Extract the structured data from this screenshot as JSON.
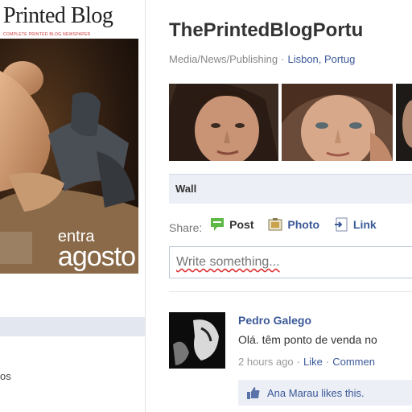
{
  "left": {
    "magazine": {
      "logo": "Printed Blog",
      "tagline": "COMPLETE PRINTED BLOG NEWSPAPER",
      "cover_line1": "entra",
      "cover_line2": "agosto"
    },
    "bottom_text": "os"
  },
  "page": {
    "title": "ThePrintedBlogPortu",
    "category": "Media/News/Publishing",
    "location": "Lisbon, Portug"
  },
  "photo_strip": {
    "icons": [
      "face-photo-1",
      "face-photo-2",
      "face-photo-3"
    ]
  },
  "wall": {
    "label": "Wall"
  },
  "share": {
    "label": "Share:",
    "post": "Post",
    "photo": "Photo",
    "link": "Link"
  },
  "composer": {
    "placeholder": "Write something..."
  },
  "story": {
    "author": "Pedro Galego",
    "text": "Olá. têm ponto de venda no",
    "time": "2 hours ago",
    "like": "Like",
    "comment": "Commen",
    "likes": "Ana Marau likes this."
  },
  "colors": {
    "link": "#3b5998",
    "wall_bg": "#eceff5",
    "post_icon": "#5fb947"
  }
}
